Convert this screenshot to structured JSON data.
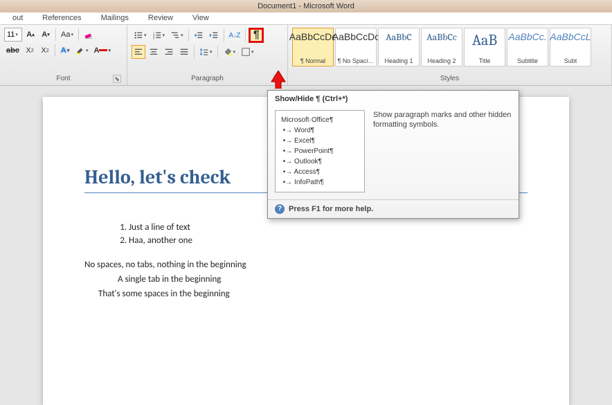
{
  "window": {
    "title": "Document1 - Microsoft Word"
  },
  "tabs": [
    "out",
    "References",
    "Mailings",
    "Review",
    "View"
  ],
  "font": {
    "size": "11",
    "group_label": "Font"
  },
  "paragraph": {
    "group_label": "Paragraph"
  },
  "styles": {
    "group_label": "Styles",
    "items": [
      {
        "preview": "AaBbCcDc",
        "label": "¶ Normal",
        "cls": "",
        "selected": true
      },
      {
        "preview": "AaBbCcDc",
        "label": "¶ No Spaci…",
        "cls": "",
        "selected": false
      },
      {
        "preview": "AaBbC",
        "label": "Heading 1",
        "cls": "blue",
        "selected": false
      },
      {
        "preview": "AaBbCc",
        "label": "Heading 2",
        "cls": "blue",
        "selected": false
      },
      {
        "preview": "AaB",
        "label": "Title",
        "cls": "bblue",
        "selected": false
      },
      {
        "preview": "AaBbCc.",
        "label": "Subtitle",
        "cls": "italic",
        "selected": false
      },
      {
        "preview": "AaBbCcL",
        "label": "Subt",
        "cls": "italic",
        "selected": false
      }
    ]
  },
  "tooltip": {
    "title": "Show/Hide ¶ (Ctrl+*)",
    "sample_header": "Microsoft·Office¶",
    "samples": [
      "Word¶",
      "Excel¶",
      "PowerPoint¶",
      "Outlook¶",
      "Access¶",
      "InfoPath¶"
    ],
    "description": "Show paragraph marks and other hidden formatting symbols.",
    "footer": "Press F1 for more help."
  },
  "document": {
    "title": "Hello, let's check",
    "list": [
      "Just a line of text",
      "Haa, another one"
    ],
    "p1": "No spaces, no tabs, nothing in the beginning",
    "p2": "A single tab in the beginning",
    "p3": "That's some spaces in the beginning"
  }
}
